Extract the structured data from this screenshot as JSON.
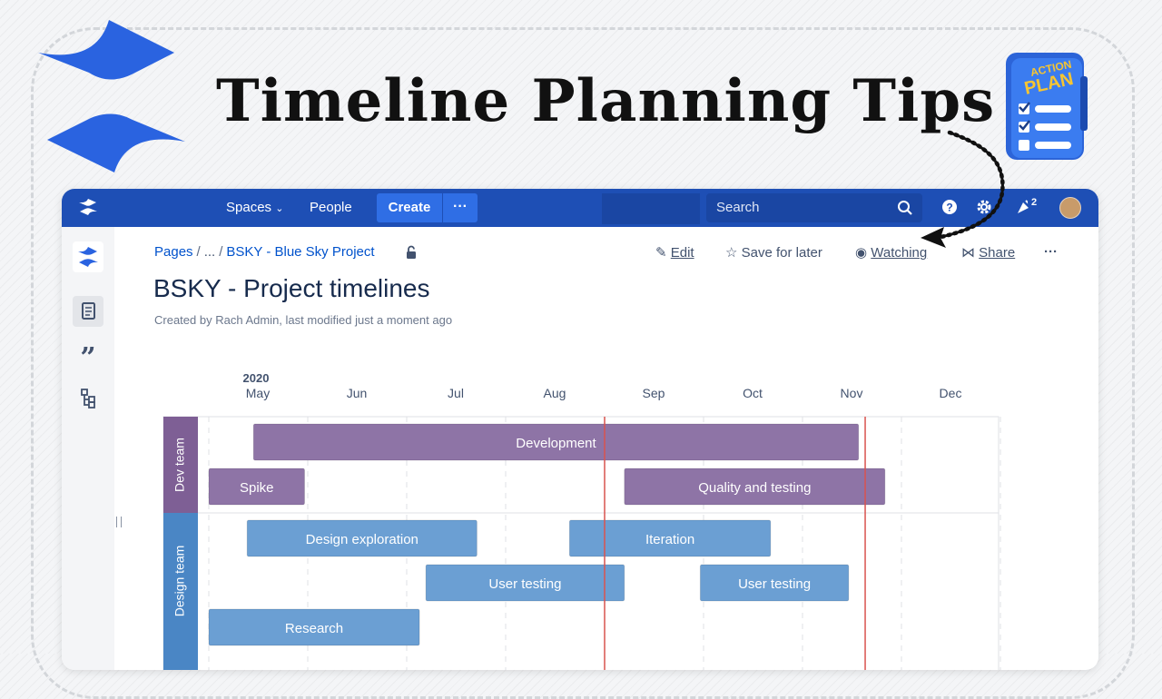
{
  "headline": "Timeline Planning Tips",
  "plan_badge": {
    "line1": "ACTION",
    "line2": "PLAN"
  },
  "nav": {
    "spaces": "Spaces",
    "people": "People",
    "create": "Create",
    "more": "···",
    "search_placeholder": "Search",
    "notification_count": "2"
  },
  "breadcrumb": {
    "pages": "Pages",
    "ellipsis": "...",
    "space": "BSKY - Blue Sky Project"
  },
  "actions": {
    "edit": "Edit",
    "save": "Save for later",
    "watching": "Watching",
    "share": "Share",
    "more": "···"
  },
  "page": {
    "title": "BSKY - Project timelines",
    "byline": "Created by Rach Admin, last modified just a moment ago"
  },
  "timeline": {
    "year": "2020",
    "months": [
      "May",
      "Jun",
      "Jul",
      "Aug",
      "Sep",
      "Oct",
      "Nov",
      "Dec"
    ],
    "groups": [
      {
        "name": "Dev team",
        "color": "#7e5f95",
        "bars": [
          {
            "label": "Development",
            "start": "2020-05-15",
            "end": "2020-11-18",
            "row": 0
          },
          {
            "label": "Spike",
            "start": "2020-05-01",
            "end": "2020-05-31",
            "row": 1
          },
          {
            "label": "Quality and testing",
            "start": "2020-09-07",
            "end": "2020-11-26",
            "row": 1
          }
        ]
      },
      {
        "name": "Design team",
        "color": "#4a86c5",
        "bars": [
          {
            "label": "Design exploration",
            "start": "2020-05-13",
            "end": "2020-07-23",
            "row": 0
          },
          {
            "label": "Iteration",
            "start": "2020-08-21",
            "end": "2020-10-22",
            "row": 0
          },
          {
            "label": "User testing",
            "start": "2020-07-07",
            "end": "2020-09-07",
            "row": 1
          },
          {
            "label": "User testing",
            "start": "2020-09-30",
            "end": "2020-11-15",
            "row": 1
          },
          {
            "label": "Research",
            "start": "2020-05-01",
            "end": "2020-07-05",
            "row": 2
          }
        ]
      }
    ],
    "markers": [
      "2020-09-01",
      "2020-11-20"
    ],
    "bar_colors": {
      "dev": "#8e74a6",
      "design": "#6b9fd3"
    },
    "marker_color": "#d9534f"
  }
}
